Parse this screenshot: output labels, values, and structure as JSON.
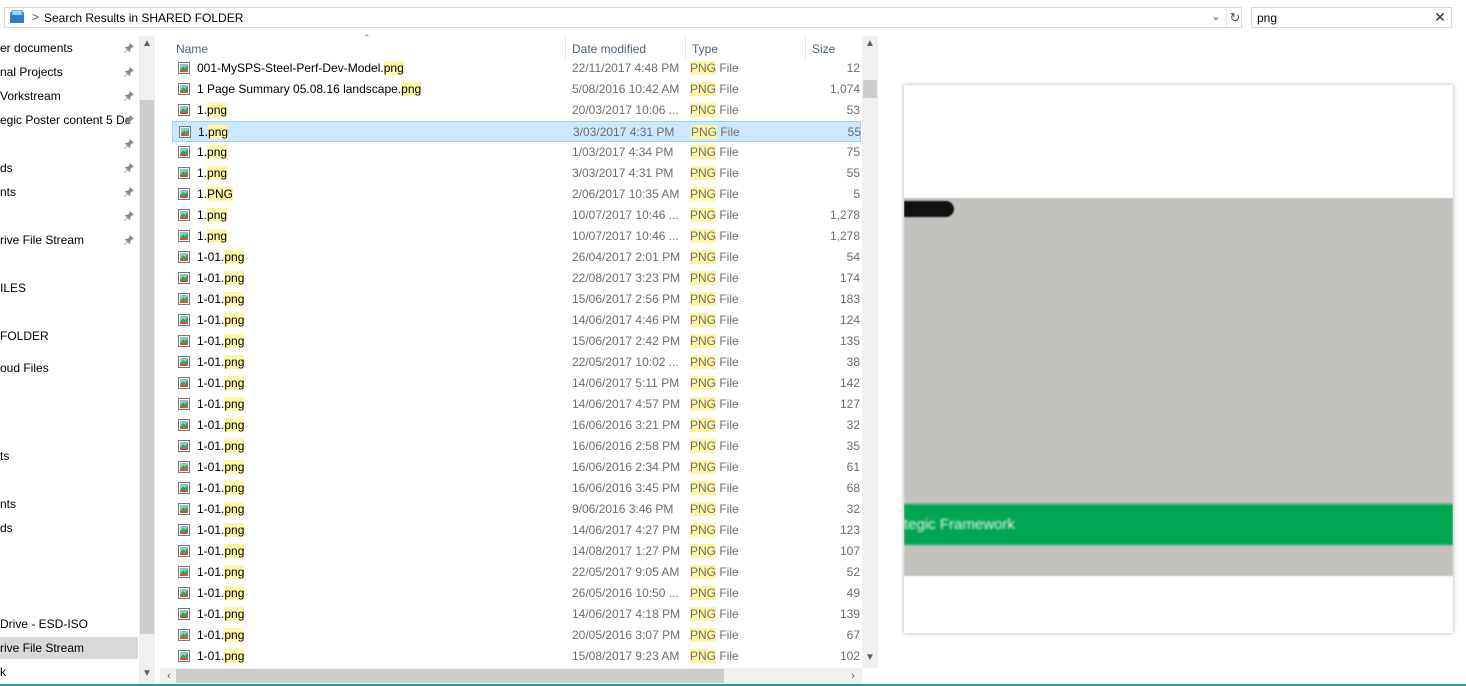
{
  "address_bar": {
    "path_separator": ">",
    "path": "Search Results in SHARED FOLDER",
    "dropdown_icon": "chevron-down-icon",
    "refresh_icon": "refresh-icon"
  },
  "search": {
    "value": "png",
    "clear_icon": "close-icon"
  },
  "nav": {
    "items": [
      {
        "label": "er documents",
        "pinned": true
      },
      {
        "label": "nal Projects",
        "pinned": true
      },
      {
        "label": "Vorkstream",
        "pinned": true
      },
      {
        "label": "egic Poster content 5 De",
        "pinned": true
      },
      {
        "label": "",
        "pinned": true
      },
      {
        "label": "ds",
        "pinned": true
      },
      {
        "label": "nts",
        "pinned": true
      },
      {
        "label": "",
        "pinned": true
      },
      {
        "label": "rive File Stream",
        "pinned": true
      },
      {
        "label": "ILES",
        "pinned": false
      },
      {
        "label": "FOLDER",
        "pinned": false
      },
      {
        "label": "oud Files",
        "pinned": false
      },
      {
        "label": "ts",
        "pinned": false
      },
      {
        "label": "nts",
        "pinned": false
      },
      {
        "label": "ds",
        "pinned": false
      },
      {
        "label": "Drive - ESD-ISO",
        "pinned": false
      },
      {
        "label": "rive File Stream",
        "pinned": false,
        "selected": true
      },
      {
        "label": "k",
        "pinned": false
      }
    ],
    "pin_glyph": "📌"
  },
  "columns": {
    "name": "Name",
    "date": "Date modified",
    "type": "Type",
    "size": "Size"
  },
  "search_term": "png",
  "files": [
    {
      "base": "001-MySPS-Steel-Perf-Dev-Model.",
      "ext": "png",
      "date": "22/11/2017 4:48 PM",
      "type_hl": "PNG",
      "type_rest": " File",
      "size": "12"
    },
    {
      "base": "1 Page Summary 05.08.16 landscape.",
      "ext": "png",
      "date": "5/08/2016 10:42 AM",
      "type_hl": "PNG",
      "type_rest": " File",
      "size": "1,074"
    },
    {
      "base": "1.",
      "ext": "png",
      "date": "20/03/2017 10:06 ...",
      "type_hl": "PNG",
      "type_rest": " File",
      "size": "53"
    },
    {
      "base": "1.",
      "ext": "png",
      "date": "3/03/2017 4:31 PM",
      "type_hl": "PNG",
      "type_rest": " File",
      "size": "55",
      "selected": true
    },
    {
      "base": "1.",
      "ext": "png",
      "date": "1/03/2017 4:34 PM",
      "type_hl": "PNG",
      "type_rest": " File",
      "size": "75"
    },
    {
      "base": "1.",
      "ext": "png",
      "date": "3/03/2017 4:31 PM",
      "type_hl": "PNG",
      "type_rest": " File",
      "size": "55"
    },
    {
      "base": "1.",
      "ext": "PNG",
      "date": "2/06/2017 10:35 AM",
      "type_hl": "PNG",
      "type_rest": " File",
      "size": "5"
    },
    {
      "base": "1.",
      "ext": "png",
      "date": "10/07/2017 10:46 ...",
      "type_hl": "PNG",
      "type_rest": " File",
      "size": "1,278"
    },
    {
      "base": "1.",
      "ext": "png",
      "date": "10/07/2017 10:46 ...",
      "type_hl": "PNG",
      "type_rest": " File",
      "size": "1,278"
    },
    {
      "base": "1-01.",
      "ext": "png",
      "date": "26/04/2017 2:01 PM",
      "type_hl": "PNG",
      "type_rest": " File",
      "size": "54"
    },
    {
      "base": "1-01.",
      "ext": "png",
      "date": "22/08/2017 3:23 PM",
      "type_hl": "PNG",
      "type_rest": " File",
      "size": "174"
    },
    {
      "base": "1-01.",
      "ext": "png",
      "date": "15/06/2017 2:56 PM",
      "type_hl": "PNG",
      "type_rest": " File",
      "size": "183"
    },
    {
      "base": "1-01.",
      "ext": "png",
      "date": "14/06/2017 4:46 PM",
      "type_hl": "PNG",
      "type_rest": " File",
      "size": "124"
    },
    {
      "base": "1-01.",
      "ext": "png",
      "date": "15/06/2017 2:42 PM",
      "type_hl": "PNG",
      "type_rest": " File",
      "size": "135"
    },
    {
      "base": "1-01.",
      "ext": "png",
      "date": "22/05/2017 10:02 ...",
      "type_hl": "PNG",
      "type_rest": " File",
      "size": "38"
    },
    {
      "base": "1-01.",
      "ext": "png",
      "date": "14/06/2017 5:11 PM",
      "type_hl": "PNG",
      "type_rest": " File",
      "size": "142"
    },
    {
      "base": "1-01.",
      "ext": "png",
      "date": "14/06/2017 4:57 PM",
      "type_hl": "PNG",
      "type_rest": " File",
      "size": "127"
    },
    {
      "base": "1-01.",
      "ext": "png",
      "date": "16/06/2016 3:21 PM",
      "type_hl": "PNG",
      "type_rest": " File",
      "size": "32"
    },
    {
      "base": "1-01.",
      "ext": "png",
      "date": "16/06/2016 2:58 PM",
      "type_hl": "PNG",
      "type_rest": " File",
      "size": "35"
    },
    {
      "base": "1-01.",
      "ext": "png",
      "date": "16/06/2016 2:34 PM",
      "type_hl": "PNG",
      "type_rest": " File",
      "size": "61"
    },
    {
      "base": "1-01.",
      "ext": "png",
      "date": "16/06/2016 3:45 PM",
      "type_hl": "PNG",
      "type_rest": " File",
      "size": "68"
    },
    {
      "base": "1-01.",
      "ext": "png",
      "date": "9/06/2016 3:46 PM",
      "type_hl": "PNG",
      "type_rest": " File",
      "size": "32"
    },
    {
      "base": "1-01.",
      "ext": "png",
      "date": "14/06/2017 4:27 PM",
      "type_hl": "PNG",
      "type_rest": " File",
      "size": "123"
    },
    {
      "base": "1-01.",
      "ext": "png",
      "date": "14/08/2017 1:27 PM",
      "type_hl": "PNG",
      "type_rest": " File",
      "size": "107"
    },
    {
      "base": "1-01.",
      "ext": "png",
      "date": "22/05/2017 9:05 AM",
      "type_hl": "PNG",
      "type_rest": " File",
      "size": "52"
    },
    {
      "base": "1-01.",
      "ext": "png",
      "date": "26/05/2016 10:50 ...",
      "type_hl": "PNG",
      "type_rest": " File",
      "size": "49"
    },
    {
      "base": "1-01.",
      "ext": "png",
      "date": "14/06/2017 4:18 PM",
      "type_hl": "PNG",
      "type_rest": " File",
      "size": "139"
    },
    {
      "base": "1-01.",
      "ext": "png",
      "date": "20/05/2016 3:07 PM",
      "type_hl": "PNG",
      "type_rest": " File",
      "size": "67"
    },
    {
      "base": "1-01.",
      "ext": "png",
      "date": "15/08/2017 9:23 AM",
      "type_hl": "PNG",
      "type_rest": " File",
      "size": "102"
    }
  ],
  "preview": {
    "tag_text": "",
    "banner_text": "tegic Framework",
    "colors": {
      "gray": "#c4c2be",
      "green": "#00a651",
      "tag": "#111111"
    }
  },
  "colors": {
    "selection_bg": "#cce8ff",
    "selection_border": "#99d1ff",
    "highlight": "#fff6a5",
    "header_text": "#4c607a",
    "window_accent": "#1a9f8a"
  }
}
